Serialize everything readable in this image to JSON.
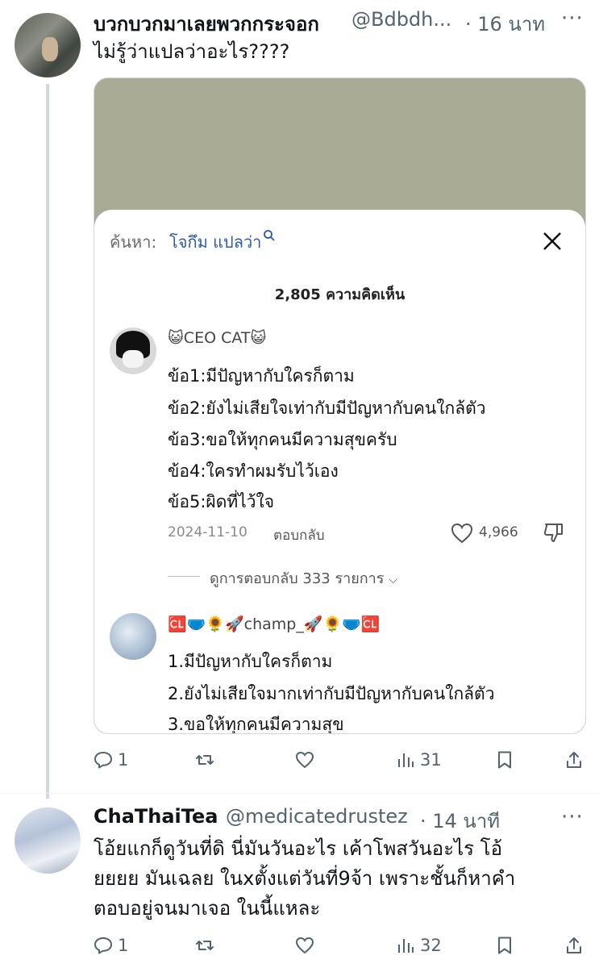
{
  "tweets": [
    {
      "display_name": "บวกบวกมาเลยพวกกระจอก",
      "handle": "@Bdbdh...",
      "time": "· 16 นาท",
      "text": "ไม่รู้ว่าแปลว่าอะไร????",
      "actions": {
        "replies": "1",
        "reposts": "",
        "likes": "",
        "views": "31"
      },
      "media": {
        "search_label": "ค้นหา:",
        "search_query": "โจกึม แปลว่า",
        "comment_count": "2,805 ความคิดเห็น",
        "comments": [
          {
            "user": "😺CEO CAT😺",
            "lines": [
              "ข้อ1:มีปัญหากับใครก็ตาม",
              "ข้อ2:ยังไม่เสียใจเท่ากับมีปัญหากับคนใกล้ตัว",
              "ข้อ3:ขอให้ทุกคนมีความสุขครับ",
              "ข้อ4:ใครทำผมรับไว้เอง",
              "ข้อ5:ผิดที่ไว้ใจ"
            ],
            "date": "2024-11-10",
            "reply_label": "ตอบกลับ",
            "likes": "4,966",
            "view_replies": "ดูการตอบกลับ 333 รายการ"
          },
          {
            "user": "🆑🩲🌻🚀champ_🚀🌻🩲🆑",
            "lines": [
              "1.มีปัญหากับใครก็ตาม",
              "2.ยังไม่เสียใจมากเท่ากับมีปัญหากับคนใกล้ตัว",
              "3.ขอให้ทุกคนมีความสุข"
            ]
          }
        ]
      }
    },
    {
      "display_name": "ChaThaiTea",
      "handle": "@medicatedrustez",
      "time": "· 14 นาที",
      "text_lines": [
        "โอ้ยแกก็ดูวันที่ดิ นี่มันวันอะไร เค้าโพสวันอะไร โอ้",
        "ยยยย มันเฉลย ในxตั้งแต่วันที่9จ้า เพราะชั้นก็หาคำ",
        "ตอบอยู่จนมาเจอ ในนี้แหละ"
      ],
      "actions": {
        "replies": "1",
        "reposts": "",
        "likes": "",
        "views": "32"
      }
    }
  ],
  "colors": {
    "text_primary": "#0f1419",
    "text_secondary": "#536471",
    "thread_line": "#cfd9de",
    "media_bg": "#a9ab94",
    "search_query": "#2d5aa8"
  }
}
